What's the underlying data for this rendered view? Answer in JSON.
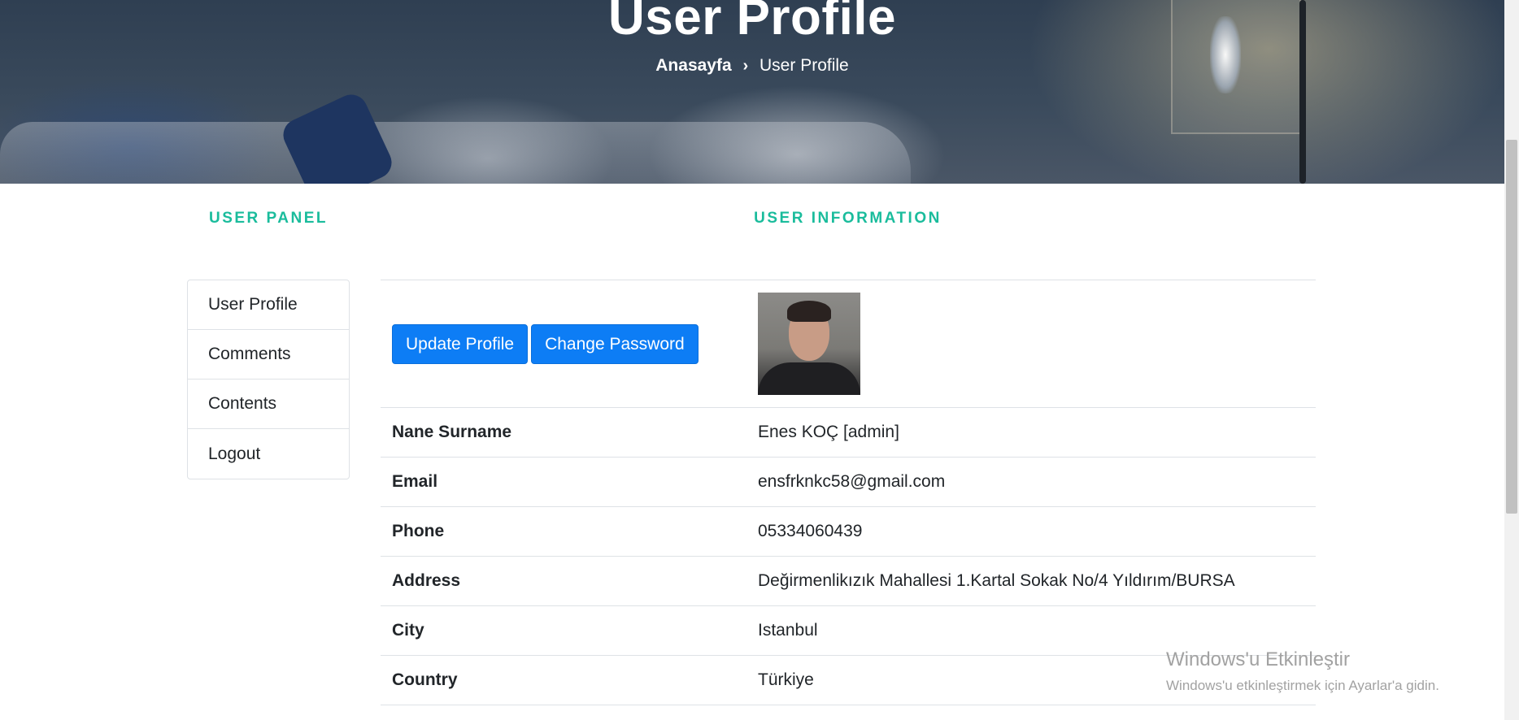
{
  "hero": {
    "title": "User Profile",
    "breadcrumb": {
      "home": "Anasayfa",
      "separator": "›",
      "current": "User Profile"
    }
  },
  "panel": {
    "heading": "USER PANEL",
    "items": [
      {
        "label": "User Profile"
      },
      {
        "label": "Comments"
      },
      {
        "label": "Contents"
      },
      {
        "label": "Logout"
      }
    ]
  },
  "info": {
    "heading": "USER INFORMATION",
    "buttons": {
      "update": "Update Profile",
      "change_password": "Change Password"
    },
    "rows": [
      {
        "label": "Nane Surname",
        "value": "Enes KOÇ [admin]"
      },
      {
        "label": "Email",
        "value": "ensfrknkc58@gmail.com"
      },
      {
        "label": "Phone",
        "value": "05334060439"
      },
      {
        "label": "Address",
        "value": "Değirmenlikızık Mahallesi 1.Kartal Sokak No/4 Yıldırım/BURSA"
      },
      {
        "label": "City",
        "value": "Istanbul"
      },
      {
        "label": "Country",
        "value": "Türkiye"
      }
    ]
  },
  "watermark": {
    "title": "Windows'u Etkinleştir",
    "subtitle": "Windows'u etkinleştirmek için Ayarlar'a gidin."
  },
  "colors": {
    "accent": "#1abc9c",
    "button": "#0d7df5"
  }
}
